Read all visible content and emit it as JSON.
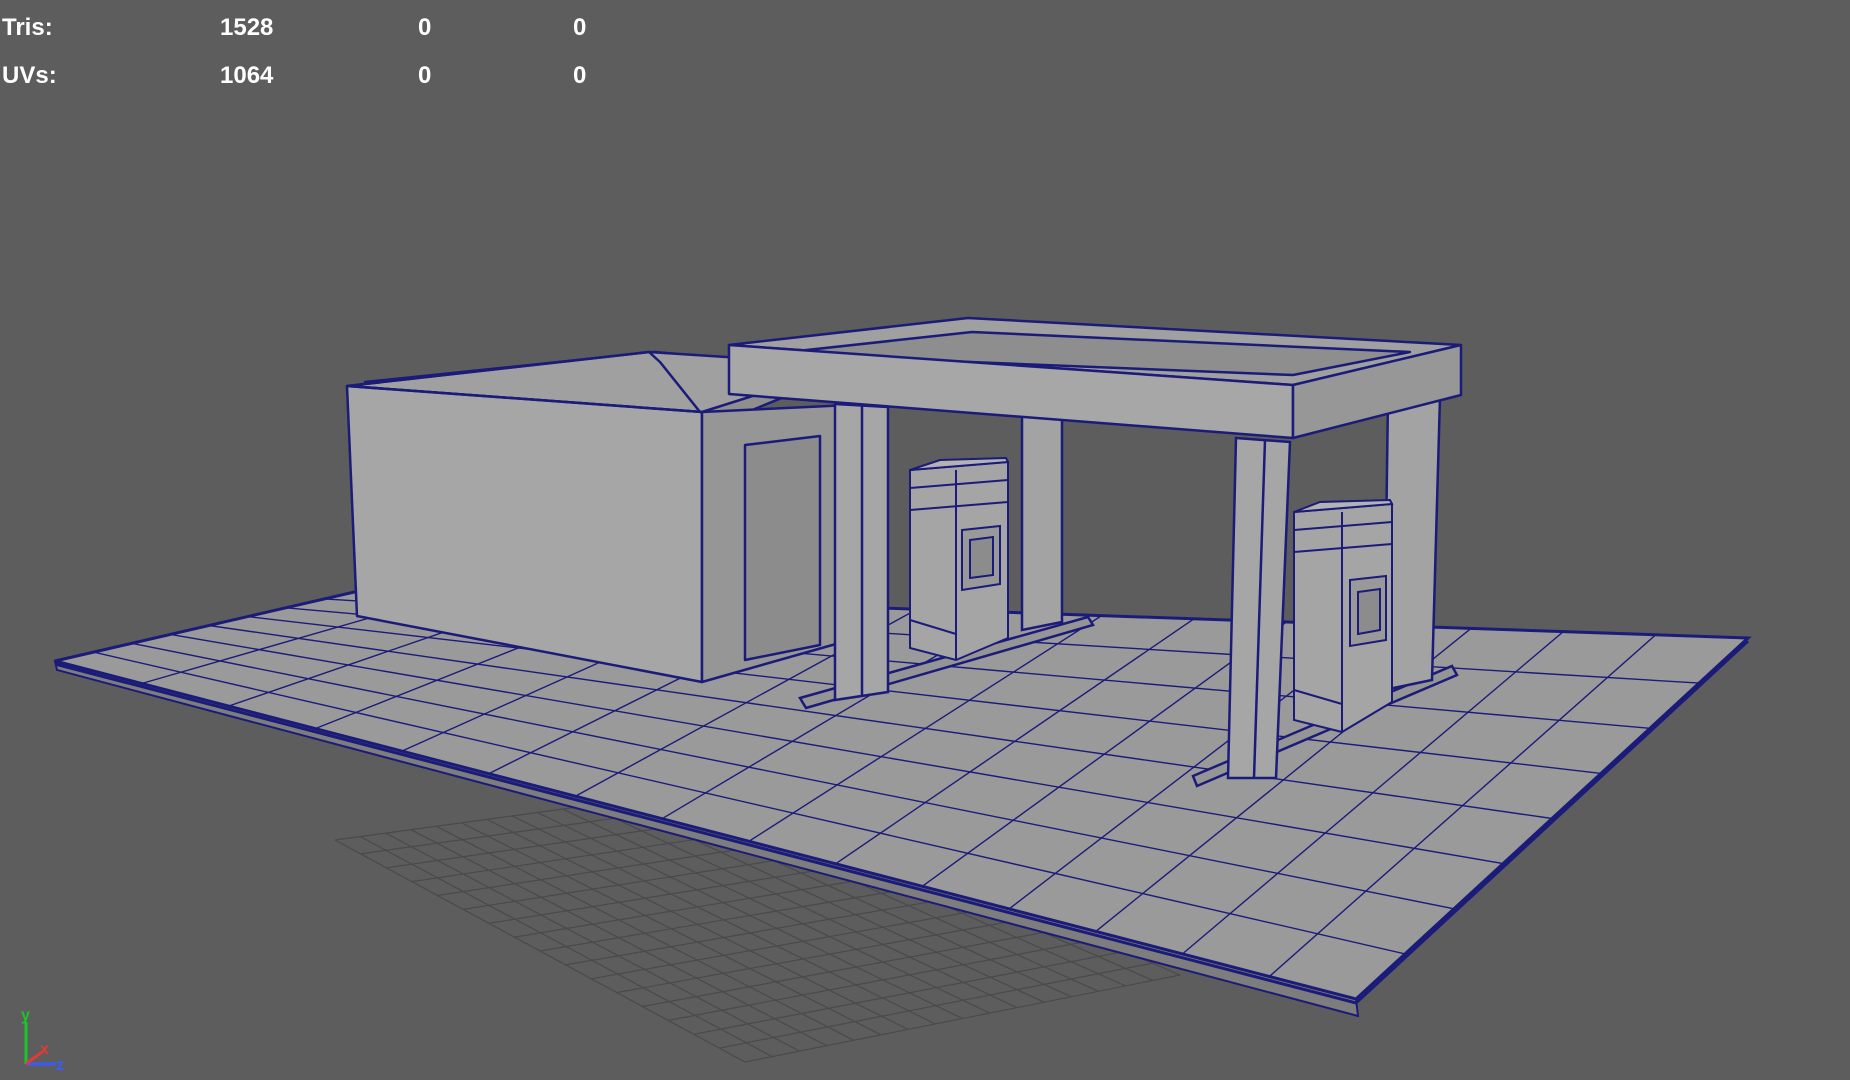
{
  "hud": {
    "rows": [
      {
        "label": "Tris:",
        "v1": "1528",
        "v2": "0",
        "v3": "0"
      },
      {
        "label": "UVs:",
        "v1": "1064",
        "v2": "0",
        "v3": "0"
      }
    ]
  },
  "axis": {
    "y": "y",
    "x": "x",
    "z": "z"
  },
  "colors": {
    "background": "#5d5d5d",
    "wireframe": "#1b1b7a",
    "surface_light": "#a3a3a3",
    "surface_mid": "#989898",
    "surface_dark": "#8c8c8c",
    "ground_grid": "#484848",
    "axis_y": "#19c72a",
    "axis_x": "#e23a3a",
    "axis_z": "#3a5bff"
  }
}
